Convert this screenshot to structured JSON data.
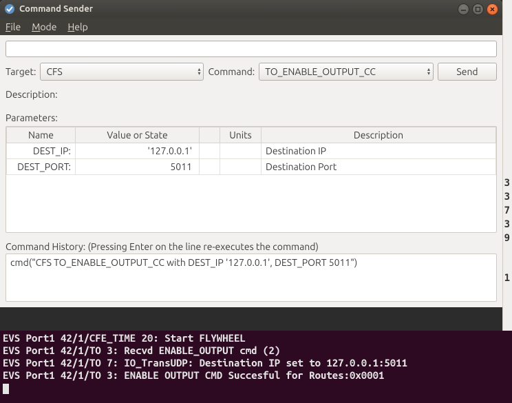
{
  "window": {
    "title": "Command Sender"
  },
  "menu": {
    "file": "File",
    "mode": "Mode",
    "help": "Help"
  },
  "search": {
    "value": ""
  },
  "targetRow": {
    "targetLabel": "Target:",
    "targetValue": "CFS",
    "commandLabel": "Command:",
    "commandValue": "TO_ENABLE_OUTPUT_CC",
    "sendLabel": "Send"
  },
  "description": {
    "label": "Description:"
  },
  "parameters": {
    "label": "Parameters:",
    "headers": {
      "name": "Name",
      "value": "Value or State",
      "units": "Units",
      "description": "Description"
    },
    "rows": [
      {
        "name": "DEST_IP:",
        "value": "'127.0.0.1'",
        "units": "",
        "description": "Destination IP"
      },
      {
        "name": "DEST_PORT:",
        "value": "5011",
        "units": "",
        "description": "Destination Port"
      }
    ]
  },
  "history": {
    "label": "Command History: (Pressing Enter on the line re-executes the command)",
    "entry": "cmd(\"CFS TO_ENABLE_OUTPUT_CC with DEST_IP '127.0.0.1', DEST_PORT 5011\")"
  },
  "terminal": {
    "lines": [
      "EVS Port1 42/1/CFE_TIME 20: Start FLYWHEEL",
      "EVS Port1 42/1/TO 3: Recvd ENABLE_OUTPUT cmd (2)",
      "EVS Port1 42/1/TO 7: IO_TransUDP: Destination IP set to 127.0.0.1:5011",
      "EVS Port1 42/1/TO 3: ENABLE OUTPUT CMD Succesful for Routes:0x0001"
    ]
  },
  "bgNumbers": [
    "3",
    "3",
    "7",
    "3",
    "9",
    "1"
  ],
  "icons": {
    "app": "app-icon",
    "minimize": "minimize-icon",
    "maximize": "maximize-icon",
    "close": "close-icon"
  }
}
